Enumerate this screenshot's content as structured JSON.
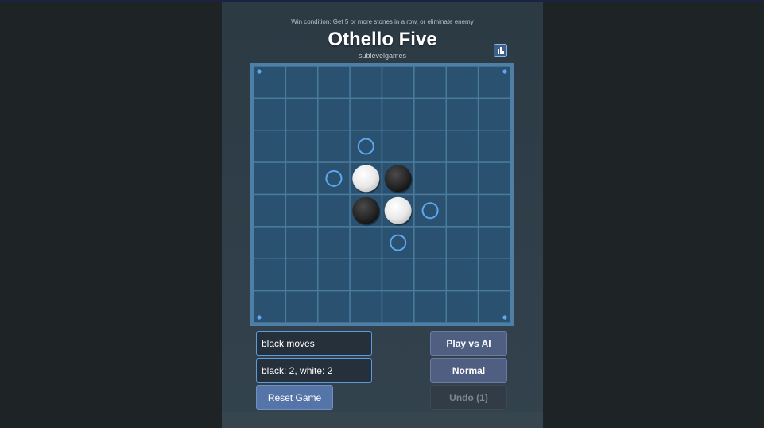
{
  "header": {
    "win_condition": "Win condition: Get 5 or more stones in a row, or eliminate enemy",
    "title": "Othello Five",
    "subtitle": "sublevelgames",
    "stats_icon": "bar-chart-icon"
  },
  "board": {
    "size": 8,
    "colors": {
      "background": "#2b5170",
      "grid": "#4a7a9c",
      "border": "#4e7fa6",
      "hint": "#5ea8f0",
      "corner_dot": "#5ea8f0"
    },
    "pieces": [
      {
        "row": 3,
        "col": 3,
        "color": "white"
      },
      {
        "row": 3,
        "col": 4,
        "color": "black"
      },
      {
        "row": 4,
        "col": 3,
        "color": "black"
      },
      {
        "row": 4,
        "col": 4,
        "color": "white"
      }
    ],
    "valid_moves": [
      {
        "row": 2,
        "col": 3
      },
      {
        "row": 3,
        "col": 2
      },
      {
        "row": 4,
        "col": 5
      },
      {
        "row": 5,
        "col": 4
      }
    ]
  },
  "status": {
    "turn": "black moves",
    "score": "black: 2, white: 2"
  },
  "controls": {
    "reset": "Reset Game",
    "mode": "Play vs AI",
    "difficulty": "Normal",
    "undo": "Undo (1)"
  }
}
